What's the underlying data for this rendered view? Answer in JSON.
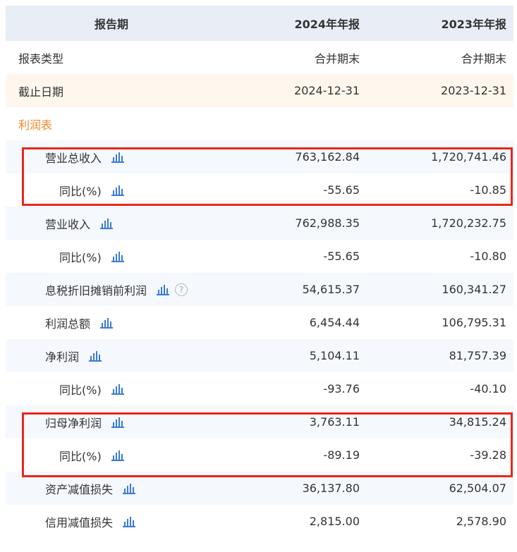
{
  "header": {
    "col_label": "报告期",
    "col_2024": "2024年年报",
    "col_2023": "2023年年报"
  },
  "rows": [
    {
      "label": "报表类型",
      "v2024": "合并期末",
      "v2023": "合并期末"
    },
    {
      "label": "截止日期",
      "v2024": "2024-12-31",
      "v2023": "2023-12-31"
    },
    {
      "label": "利润表"
    },
    {
      "label": "营业总收入",
      "v2024": "763,162.84",
      "v2023": "1,720,741.46"
    },
    {
      "label": "同比(%)",
      "v2024": "-55.65",
      "v2023": "-10.85"
    },
    {
      "label": "营业收入",
      "v2024": "762,988.35",
      "v2023": "1,720,232.75"
    },
    {
      "label": "同比(%)",
      "v2024": "-55.65",
      "v2023": "-10.80"
    },
    {
      "label": "息税折旧摊销前利润",
      "v2024": "54,615.37",
      "v2023": "160,341.27"
    },
    {
      "label": "利润总额",
      "v2024": "6,454.44",
      "v2023": "106,795.31"
    },
    {
      "label": "净利润",
      "v2024": "5,104.11",
      "v2023": "81,757.39"
    },
    {
      "label": "同比(%)",
      "v2024": "-93.76",
      "v2023": "-40.10"
    },
    {
      "label": "归母净利润",
      "v2024": "3,763.11",
      "v2023": "34,815.24"
    },
    {
      "label": "同比(%)",
      "v2024": "-89.19",
      "v2023": "-39.28"
    },
    {
      "label": "资产减值损失",
      "v2024": "36,137.80",
      "v2023": "62,504.07"
    },
    {
      "label": "信用减值损失",
      "v2024": "2,815.00",
      "v2023": "2,578.90"
    }
  ],
  "icons": {
    "chart": "bar-chart-icon",
    "help": "question-mark-icon",
    "help_glyph": "?"
  },
  "colors": {
    "header_bg": "#e9edf6",
    "alt_row_bg": "#f5f8fd",
    "date_row_bg": "#fff7ee",
    "section_text": "#f08a2a",
    "highlight": "#e8271c",
    "icon_blue": "#3a7bd5"
  }
}
